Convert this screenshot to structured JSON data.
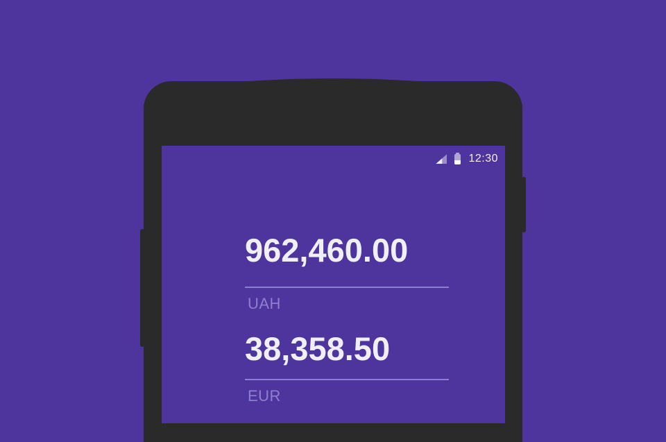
{
  "status_bar": {
    "time": "12:30",
    "signal_icon": "cellular-signal-icon",
    "battery_icon": "battery-icon"
  },
  "converter": {
    "from": {
      "amount": "962,460.00",
      "currency": "UAH"
    },
    "to": {
      "amount": "38,358.50",
      "currency": "EUR"
    }
  },
  "colors": {
    "background": "#4e359e",
    "phone_body": "#2a2a2a",
    "text": "#f0eef6",
    "accent": "#8e7fd0"
  }
}
